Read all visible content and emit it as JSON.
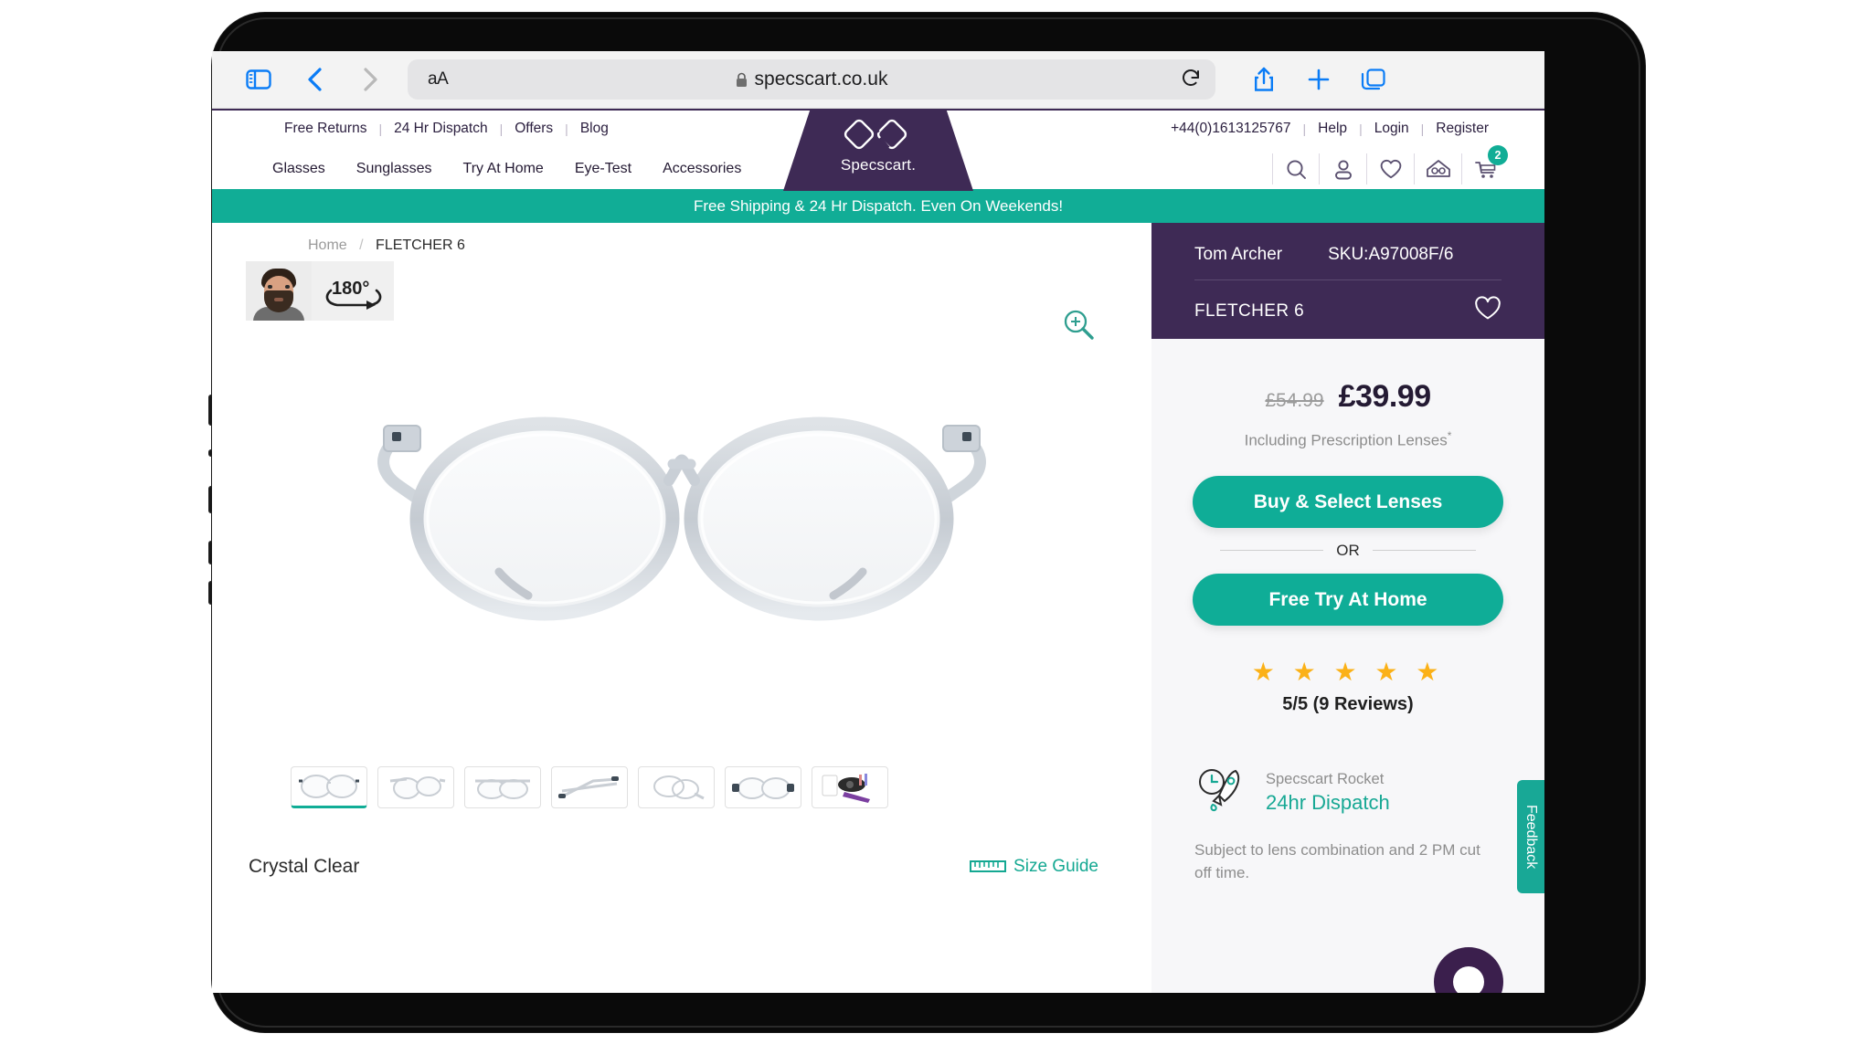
{
  "browser": {
    "aa_label": "aA",
    "url": "specscart.co.uk",
    "lock_icon": "lock-icon",
    "sidebar_icon": "sidebar-icon",
    "back_icon": "chevron-left-icon",
    "forward_icon": "chevron-right-icon",
    "reload_icon": "reload-icon",
    "share_icon": "share-icon",
    "newtab_icon": "plus-icon",
    "tabs_icon": "tabs-icon"
  },
  "header": {
    "topbar_links": [
      "Free Returns",
      "24 Hr Dispatch",
      "Offers",
      "Blog"
    ],
    "phone": "+44(0)1613125767",
    "account_links": [
      "Help",
      "Login",
      "Register"
    ],
    "nav_links": [
      "Glasses",
      "Sunglasses",
      "Try At Home",
      "Eye-Test",
      "Accessories"
    ],
    "logo_text": "Specscart.",
    "icons": [
      {
        "name": "search-icon"
      },
      {
        "name": "user-icon"
      },
      {
        "name": "heart-icon"
      },
      {
        "name": "try-at-home-icon"
      },
      {
        "name": "cart-icon",
        "badge": "2"
      }
    ],
    "cart_count": "2"
  },
  "promo": {
    "text": "Free Shipping & 24 Hr Dispatch. Even On Weekends!",
    "bg_color": "#11ad96"
  },
  "breadcrumb": {
    "home": "Home",
    "separator": "/",
    "current": "FLETCHER 6"
  },
  "gallery": {
    "preview_label": "180°",
    "zoom_icon": "magnifier-plus-icon",
    "thumbs": [
      {
        "name": "thumb-front-view",
        "active": true
      },
      {
        "name": "thumb-angled-view",
        "active": false
      },
      {
        "name": "thumb-three-quarter-view",
        "active": false
      },
      {
        "name": "thumb-side-temple-view",
        "active": false
      },
      {
        "name": "thumb-folded-view",
        "active": false
      },
      {
        "name": "thumb-top-view",
        "active": false
      },
      {
        "name": "thumb-packaging-kit",
        "active": false
      }
    ],
    "color_name": "Crystal Clear",
    "size_guide_label": "Size Guide",
    "size_guide_icon": "ruler-icon"
  },
  "product": {
    "brand": "Tom Archer",
    "sku": "SKU:A97008F/6",
    "name": "FLETCHER 6",
    "wishlist_icon": "heart-outline-icon",
    "old_price": "£54.99",
    "price": "£39.99",
    "price_note": "Including Prescription Lenses",
    "price_note_sup": "*",
    "cta_primary": "Buy & Select Lenses",
    "or_label": "OR",
    "cta_secondary": "Free Try At Home",
    "stars": "★ ★ ★ ★ ★",
    "rating_text": "5/5 (9 Reviews)",
    "accent_color": "#0fad97",
    "header_bg_color": "#3e2a55"
  },
  "dispatch": {
    "icon": "rocket-clock-icon",
    "label": "Specscart Rocket",
    "headline": "24hr Dispatch",
    "note": "Subject to lens combination and 2 PM cut off time."
  },
  "widgets": {
    "feedback_label": "Feedback",
    "chat_icon": "chat-bubble-icon"
  }
}
